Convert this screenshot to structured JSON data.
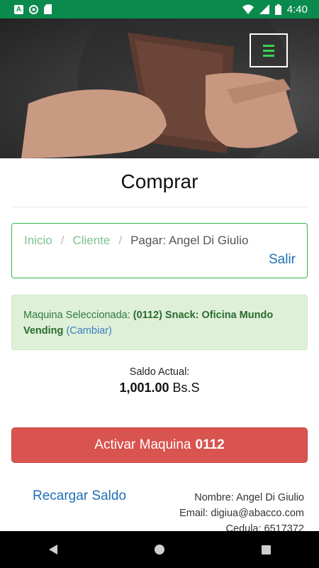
{
  "status_bar": {
    "time": "4:40",
    "a_icon_letter": "A"
  },
  "header": {
    "menu_icon": "hamburger-icon",
    "accent_color": "#39d353"
  },
  "page": {
    "title": "Comprar"
  },
  "breadcrumb": {
    "items": [
      "Inicio",
      "Cliente",
      "Pagar: Angel Di Giulio"
    ],
    "separator": "/",
    "logout_label": "Salir"
  },
  "machine": {
    "label": "Maquina Seleccionada:",
    "value": "(0112) Snack: Oficina Mundo Vending",
    "change_label": "(Cambiar)"
  },
  "balance": {
    "label": "Saldo Actual:",
    "amount": "1,001.00",
    "currency": "Bs.S"
  },
  "activate_button": {
    "label": "Activar Maquina",
    "code": "0112",
    "color": "#d9534f"
  },
  "recharge_label": "Recargar Saldo",
  "user": {
    "name": "Nombre: Angel Di Giulio",
    "email": "Email: digiua@abacco.com",
    "id": "Cedula: 6517372"
  },
  "nav_bar": {
    "back_icon": "back-icon",
    "home_icon": "home-icon",
    "recent_icon": "recent-apps-icon"
  }
}
